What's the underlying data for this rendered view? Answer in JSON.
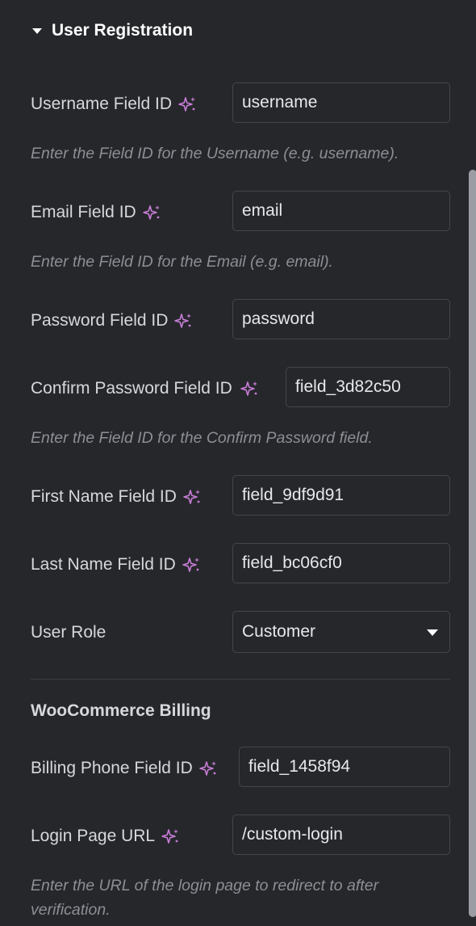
{
  "section": {
    "title": "User Registration"
  },
  "fields": {
    "username": {
      "label": "Username Field ID",
      "value": "username",
      "help": "Enter the Field ID for the Username (e.g. username)."
    },
    "email": {
      "label": "Email Field ID",
      "value": "email",
      "help": "Enter the Field ID for the Email (e.g. email)."
    },
    "password": {
      "label": "Password Field ID",
      "value": "password"
    },
    "confirm_password": {
      "label": "Confirm Password Field ID",
      "value": "field_3d82c50",
      "help": "Enter the Field ID for the Confirm Password field."
    },
    "first_name": {
      "label": "First Name Field ID",
      "value": "field_9df9d91"
    },
    "last_name": {
      "label": "Last Name Field ID",
      "value": "field_bc06cf0"
    },
    "user_role": {
      "label": "User Role",
      "value": "Customer"
    }
  },
  "woocommerce": {
    "heading": "WooCommerce Billing",
    "billing_phone": {
      "label": "Billing Phone Field ID",
      "value": "field_1458f94"
    },
    "login_page": {
      "label": "Login Page URL",
      "value": "/custom-login",
      "help": "Enter the URL of the login page to redirect to after verification."
    }
  },
  "icons": {
    "ai": "ai-sparkle-icon",
    "section_toggle": "caret-down-icon",
    "select": "caret-down-icon"
  },
  "colors": {
    "background": "#26272b",
    "ai_icon": "#c77dd6",
    "input_border": "#44464b",
    "help_text": "#8b8f95"
  }
}
